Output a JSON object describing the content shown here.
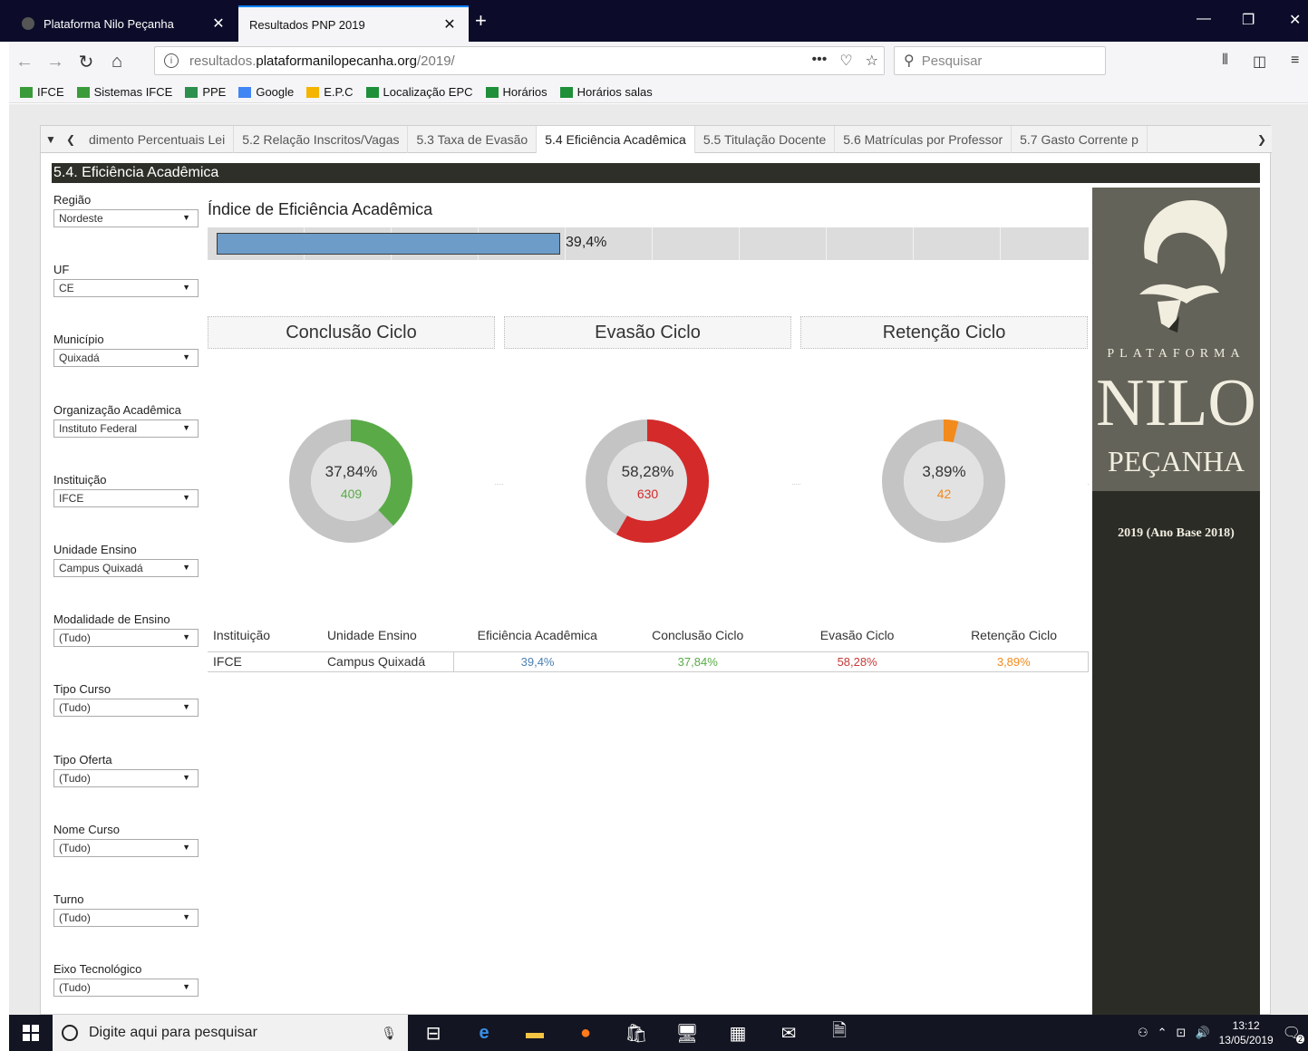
{
  "browser": {
    "tabs": [
      {
        "title": "Plataforma Nilo Peçanha"
      },
      {
        "title": "Resultados PNP 2019"
      }
    ],
    "url_prefix": "resultados.",
    "url_domain": "plataformanilopecanha.org",
    "url_path": "/2019/",
    "search_placeholder": "Pesquisar",
    "bookmarks": [
      {
        "label": "IFCE",
        "icon": "ifce-icon"
      },
      {
        "label": "Sistemas IFCE",
        "icon": "ifce-icon"
      },
      {
        "label": "PPE",
        "icon": "sheet-icon"
      },
      {
        "label": "Google",
        "icon": "google-icon"
      },
      {
        "label": "E.P.C",
        "icon": "drive-icon"
      },
      {
        "label": "Localização EPC",
        "icon": "plus-icon"
      },
      {
        "label": "Horários",
        "icon": "plus-icon"
      },
      {
        "label": "Horários salas",
        "icon": "plus-icon"
      }
    ]
  },
  "sheet_tabs": [
    {
      "label": "dimento Percentuais Lei",
      "active": false
    },
    {
      "label": "5.2 Relação Inscritos/Vagas",
      "active": false
    },
    {
      "label": "5.3 Taxa de Evasão",
      "active": false
    },
    {
      "label": "5.4 Eficiência Acadêmica",
      "active": true
    },
    {
      "label": "5.5 Titulação Docente",
      "active": false
    },
    {
      "label": "5.6 Matrículas por Professor",
      "active": false
    },
    {
      "label": "5.7 Gasto Corrente p",
      "active": false
    }
  ],
  "section_title": "5.4. Eficiência Acadêmica",
  "filters": [
    {
      "label": "Região",
      "value": "Nordeste"
    },
    {
      "label": "UF",
      "value": "CE"
    },
    {
      "label": "Município",
      "value": "Quixadá"
    },
    {
      "label": "Organização Acadêmica",
      "value": "Instituto Federal"
    },
    {
      "label": "Instituição",
      "value": "IFCE"
    },
    {
      "label": "Unidade Ensino",
      "value": "Campus Quixadá"
    },
    {
      "label": "Modalidade de Ensino",
      "value": "(Tudo)"
    },
    {
      "label": "Tipo Curso",
      "value": "(Tudo)"
    },
    {
      "label": "Tipo Oferta",
      "value": "(Tudo)"
    },
    {
      "label": "Nome Curso",
      "value": "(Tudo)"
    },
    {
      "label": "Turno",
      "value": "(Tudo)"
    },
    {
      "label": "Eixo Tecnológico",
      "value": "(Tudo)"
    }
  ],
  "index": {
    "title": "Índice de Eficiência Acadêmica",
    "value": 39.4,
    "max": 100,
    "label": "39,4%"
  },
  "donuts": [
    {
      "title": "Conclusão Ciclo",
      "pct": 37.84,
      "pct_label": "37,84%",
      "count": "409",
      "color": "#5aab48"
    },
    {
      "title": "Evasão Ciclo",
      "pct": 58.28,
      "pct_label": "58,28%",
      "count": "630",
      "color": "#d42a2a"
    },
    {
      "title": "Retenção Ciclo",
      "pct": 3.89,
      "pct_label": "3,89%",
      "count": "42",
      "color": "#f28a1c"
    }
  ],
  "table": {
    "headers": [
      "Instituição",
      "Unidade Ensino",
      "Eficiência Acadêmica",
      "Conclusão Ciclo",
      "Evasão Ciclo",
      "Retenção Ciclo"
    ],
    "rows": [
      [
        "IFCE",
        "Campus Quixadá",
        "39,4%",
        "37,84%",
        "58,28%",
        "3,89%"
      ]
    ],
    "value_colors": [
      "#4a7fb0",
      "#5aab48",
      "#c43a3a",
      "#f28a1c"
    ]
  },
  "logo": {
    "line1": "PLATAFORMA",
    "line2": "NILO",
    "line3": "PEÇANHA",
    "year": "2019 (Ano Base 2018)"
  },
  "taskbar": {
    "search_placeholder": "Digite aqui para pesquisar",
    "time": "13:12",
    "date": "13/05/2019",
    "notifications": "2"
  }
}
